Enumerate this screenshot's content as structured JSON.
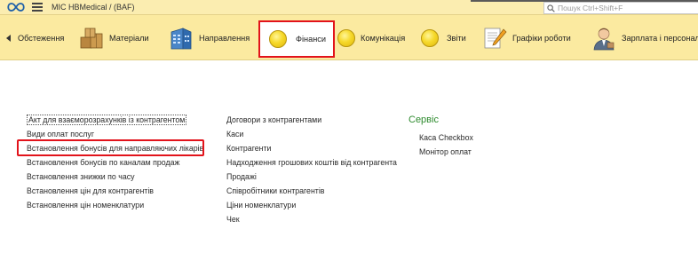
{
  "app": {
    "title": "МІС HBMedical / (BAF)"
  },
  "search": {
    "placeholder": "Пошук Ctrl+Shift+F"
  },
  "sections": [
    {
      "label": "Обстеження",
      "icon": "none"
    },
    {
      "label": "Матеріали",
      "icon": "boxes-icon"
    },
    {
      "label": "Направлення",
      "icon": "building-icon"
    },
    {
      "label": "Фінанси",
      "icon": "coin-icon",
      "active": true
    },
    {
      "label": "Комунікація",
      "icon": "coin-icon"
    },
    {
      "label": "Звіти",
      "icon": "coin-icon"
    },
    {
      "label": "Графіки роботи",
      "icon": "document-pencil-icon"
    },
    {
      "label": "Зарплата і персонал",
      "icon": "person-icon"
    }
  ],
  "columns": {
    "left": [
      "Акт для взаєморозрахунків із контрагентом",
      "Види оплат послуг",
      "Встановлення бонусів для направляючих лікарів",
      "Встановлення бонусів по каналам продаж",
      "Встановлення знижки по часу",
      "Встановлення цін для контрагентів",
      "Встановлення цін номенклатури"
    ],
    "middle": [
      "Договори з контрагентами",
      "Каси",
      "Контрагенти",
      "Надходження грошових коштів від контрагента",
      "Продажі",
      "Співробітники контрагентів",
      "Ціни номенклатури",
      "Чек"
    ],
    "service": {
      "title": "Сервіс",
      "items": [
        "Каса Checkbox",
        "Монітор оплат"
      ]
    }
  },
  "colors": {
    "accent_red": "#e2131b",
    "panel_yellow": "#fbeaa0",
    "service_green": "#2d8a2d"
  }
}
